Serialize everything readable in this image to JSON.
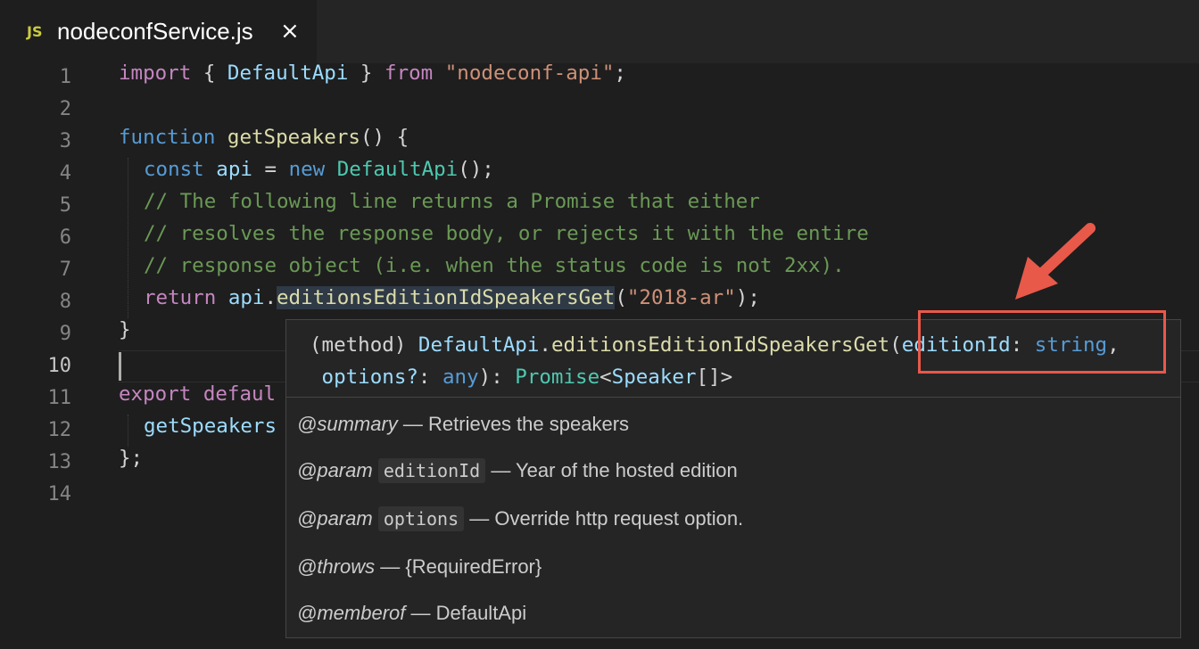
{
  "tab": {
    "icon": "JS",
    "title": "nodeconfService.js",
    "close": "×"
  },
  "line_numbers": [
    "1",
    "2",
    "3",
    "4",
    "5",
    "6",
    "7",
    "8",
    "9",
    "10",
    "11",
    "12",
    "13",
    "14"
  ],
  "code": {
    "l1": {
      "import": "import",
      "b1": " { ",
      "cls": "DefaultApi",
      "b2": " } ",
      "from": "from",
      "sp": " ",
      "str": "\"nodeconf-api\"",
      "semi": ";"
    },
    "l3": {
      "function": "function",
      "sp": " ",
      "name": "getSpeakers",
      "rest": "() {"
    },
    "l4": {
      "const": "const",
      "sp1": " ",
      "api": "api",
      "eq": " = ",
      "new": "new",
      "sp2": " ",
      "cls": "DefaultApi",
      "rest": "();"
    },
    "l5": "// The following line returns a Promise that either",
    "l6": "// resolves the response body, or rejects it with the entire",
    "l7": "// response object (i.e. when the status code is not 2xx).",
    "l8": {
      "return": "return",
      "sp": " ",
      "api": "api",
      "dot": ".",
      "method": "editionsEditionIdSpeakersGet",
      "open": "(",
      "str": "\"2018-ar\"",
      "close": ");"
    },
    "l9": "}",
    "l11": {
      "export": "export",
      "sp": " ",
      "default": "defaul"
    },
    "l12": "getSpeakers",
    "l13": "};"
  },
  "hover": {
    "sig1": {
      "p1": "(method) ",
      "cls": "DefaultApi",
      "dot": ".",
      "method": "editionsEditionIdSpeakersGet",
      "open": "(",
      "param": "editionId",
      "colon": ": ",
      "type": "string",
      "comma": ","
    },
    "sig2": {
      "sp": " ",
      "param": "options?",
      "colon": ": ",
      "type": "any",
      "close": "): ",
      "promise": "Promise",
      "lt": "<",
      "speaker": "Speaker",
      "rest": "[]>"
    },
    "docs": [
      {
        "tag": "@summary",
        "code": "",
        "text": " — Retrieves the speakers"
      },
      {
        "tag": "@param",
        "code": "editionId",
        "text": " — Year of the hosted edition"
      },
      {
        "tag": "@param",
        "code": "options",
        "text": " — Override http request option."
      },
      {
        "tag": "@throws",
        "code": "",
        "text": " — {RequiredError}"
      },
      {
        "tag": "@memberof",
        "code": "",
        "text": " — DefaultApi"
      }
    ]
  },
  "colors": {
    "highlight": "#e8594a",
    "background": "#1e1e1e"
  }
}
